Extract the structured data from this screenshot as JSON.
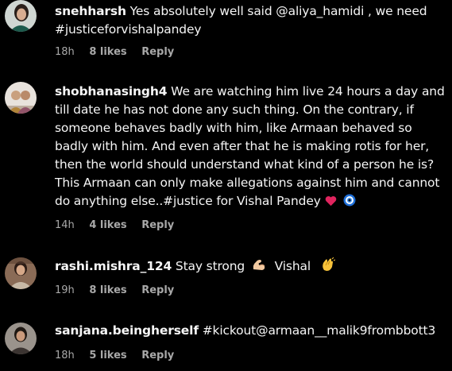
{
  "comments": [
    {
      "username": "snehharsh",
      "text": "Yes absolutely well said @aliya_hamidi , we need #justiceforvishalpandey",
      "time": "18h",
      "likes": "8 likes",
      "reply": "Reply"
    },
    {
      "username": "shobhanasingh4",
      "text": "We are watching him live 24 hours a day and till date he has not done any such thing. On the contrary, if someone behaves badly with him, like Armaan behaved so badly with him. And even after that he is making rotis for her, then the world should understand what kind of a person he is? This Armaan can only make allegations against him and cannot do anything else..#justice for Vishal Pandey",
      "time": "14h",
      "likes": "4 likes",
      "reply": "Reply"
    },
    {
      "username": "rashi.mishra_124",
      "text_before": "Stay strong",
      "text_after": "Vishal",
      "time": "19h",
      "likes": "8 likes",
      "reply": "Reply"
    },
    {
      "username": "sanjana.beingherself",
      "text": "#kickout@armaan__malik9frombbott3",
      "time": "18h",
      "likes": "5 likes",
      "reply": "Reply"
    }
  ],
  "icons": {
    "heart": "red-heart-icon",
    "nazar": "nazar-amulet-icon",
    "muscle": "flexed-biceps-icon",
    "clap": "clapping-hands-icon"
  },
  "colors": {
    "background": "#000000",
    "text": "#f5f5f5",
    "meta": "#a8a8a8",
    "heart": "#e0245e",
    "nazar": "#1e6fd9"
  }
}
